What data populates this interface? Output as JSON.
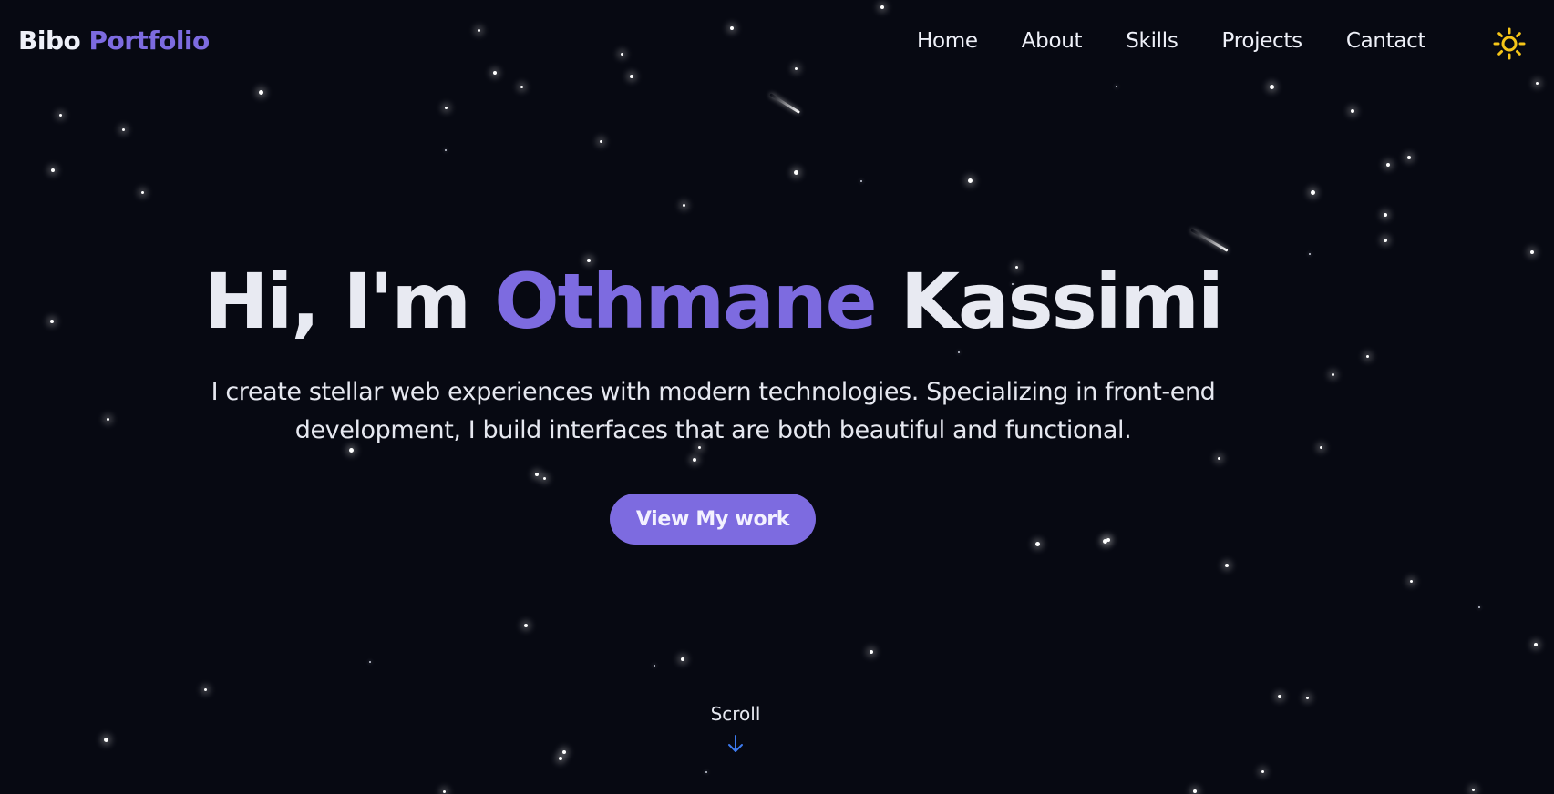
{
  "brand": {
    "first": "Bibo",
    "second": "Portfolio"
  },
  "nav": {
    "items": [
      {
        "id": "home",
        "label": "Home"
      },
      {
        "id": "about",
        "label": "About"
      },
      {
        "id": "skills",
        "label": "Skills"
      },
      {
        "id": "projects",
        "label": "Projects"
      },
      {
        "id": "contact",
        "label": "Cantact"
      }
    ],
    "theme_toggle_icon": "sun-icon"
  },
  "hero": {
    "greeting": "Hi, I'm",
    "first_name": "Othmane",
    "last_name": "Kassimi",
    "subtitle": "I create stellar web experiences with modern technologies. Specializing in front-end development, I build interfaces that are both beautiful and functional.",
    "cta_label": "View My work"
  },
  "scroll": {
    "label": "Scroll",
    "icon": "arrow-down-icon"
  },
  "colors": {
    "background": "#070912",
    "accent": "#7d6be0",
    "text": "#e8eaf2",
    "sun": "#f5c518",
    "scroll_arrow": "#3d7bf0"
  }
}
